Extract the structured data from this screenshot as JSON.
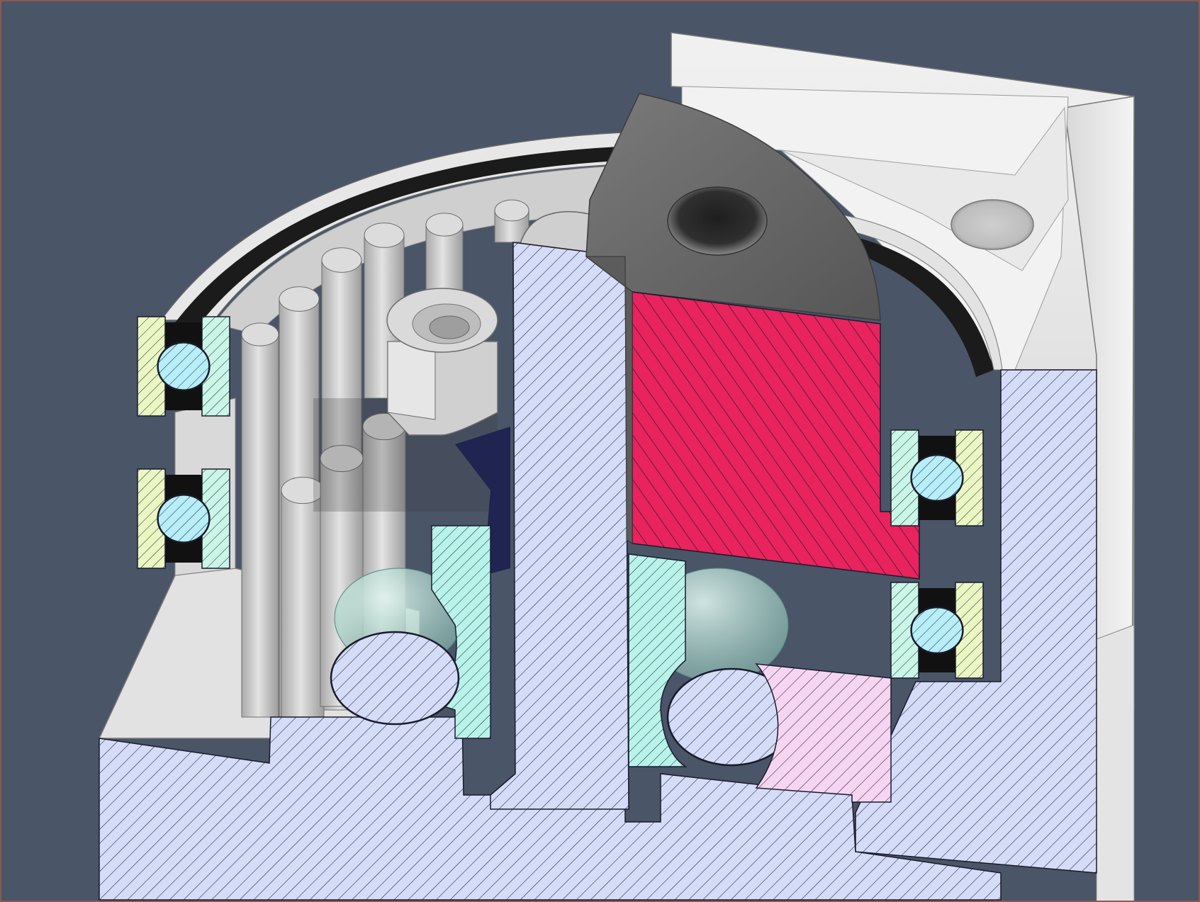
{
  "viewport": {
    "background": "#4a5568",
    "frame_border": "#8a5a52"
  },
  "colors": {
    "housing_section": "#d4dcf7",
    "housing_surface": "#e6e6e6",
    "shaft_section": "#d4dcf7",
    "cam_block_section": "#e8235e",
    "cam_block_top": "#6e6e6e",
    "bearing_outer_race": "#eaf7c3",
    "bearing_inner_race": "#c9f6e6",
    "bearing_ball": "#b6eef9",
    "bearing_seal": "#111111",
    "sleeve_section": "#b8f3ea",
    "roller_section": "#d4dcf7",
    "bushing_section": "#f6d5f2",
    "pins": "#c8c8c8",
    "hex_nut": "#d8d8d8",
    "hatch_line": "#1a1a2a"
  },
  "parts": [
    {
      "id": "housing",
      "icon": "housing-section-icon"
    },
    {
      "id": "center-shaft",
      "icon": "shaft-section-icon"
    },
    {
      "id": "cam-block",
      "icon": "cam-block-icon"
    },
    {
      "id": "bearing-left-upper",
      "icon": "bearing-icon"
    },
    {
      "id": "bearing-left-lower",
      "icon": "bearing-icon"
    },
    {
      "id": "bearing-right-upper",
      "icon": "bearing-icon"
    },
    {
      "id": "bearing-right-lower",
      "icon": "bearing-icon"
    },
    {
      "id": "hex-nut",
      "icon": "hex-nut-icon"
    },
    {
      "id": "pin-ring",
      "icon": "pin-icon"
    },
    {
      "id": "sleeve-left",
      "icon": "sleeve-section-icon"
    },
    {
      "id": "sleeve-right",
      "icon": "sleeve-section-icon"
    },
    {
      "id": "roller-left",
      "icon": "roller-section-icon"
    },
    {
      "id": "roller-right",
      "icon": "roller-section-icon"
    },
    {
      "id": "bushing",
      "icon": "bushing-section-icon"
    }
  ]
}
